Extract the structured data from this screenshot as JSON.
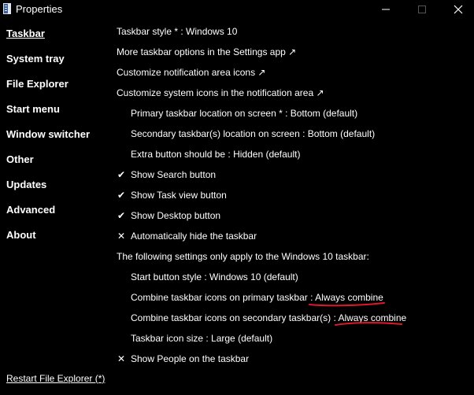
{
  "window": {
    "title": "Properties",
    "minimize_icon": "minimize-icon",
    "maximize_icon": "maximize-icon",
    "close_icon": "close-icon"
  },
  "sidebar": {
    "items": [
      {
        "label": "Taskbar",
        "active": true
      },
      {
        "label": "System tray",
        "active": false
      },
      {
        "label": "File Explorer",
        "active": false
      },
      {
        "label": "Start menu",
        "active": false
      },
      {
        "label": "Window switcher",
        "active": false
      },
      {
        "label": "Other",
        "active": false
      },
      {
        "label": "Updates",
        "active": false
      },
      {
        "label": "Advanced",
        "active": false
      },
      {
        "label": "About",
        "active": false
      }
    ],
    "restart_label": "Restart File Explorer (*)"
  },
  "settings": {
    "taskbar_style": "Taskbar style * : Windows 10",
    "more_options": "More taskbar options in the Settings app ↗",
    "notification_icons": "Customize notification area icons ↗",
    "system_icons": "Customize system icons in the notification area ↗",
    "primary_location": "Primary taskbar location on screen * : Bottom (default)",
    "secondary_location": "Secondary taskbar(s) location on screen : Bottom (default)",
    "extra_button": "Extra button should be : Hidden (default)",
    "show_search": "Show Search button",
    "show_task_view": "Show Task view button",
    "show_desktop": "Show Desktop button",
    "auto_hide": "Automatically hide the taskbar",
    "win10_header": "The following settings only apply to the Windows 10 taskbar:",
    "start_button_style": "Start button style : Windows 10 (default)",
    "combine_primary_label": "Combine taskbar icons on primary taskbar : ",
    "combine_primary_value": "Always combine",
    "combine_secondary_label": "Combine taskbar icons on secondary taskbar(s) : ",
    "combine_secondary_value": "Always combine",
    "icon_size": "Taskbar icon size : Large (default)",
    "show_people": "Show People on the taskbar"
  },
  "marks": {
    "checked": "✔",
    "unchecked": "✕"
  },
  "colors": {
    "background": "#000000",
    "text": "#ffffff",
    "annotation": "#e0182b"
  }
}
